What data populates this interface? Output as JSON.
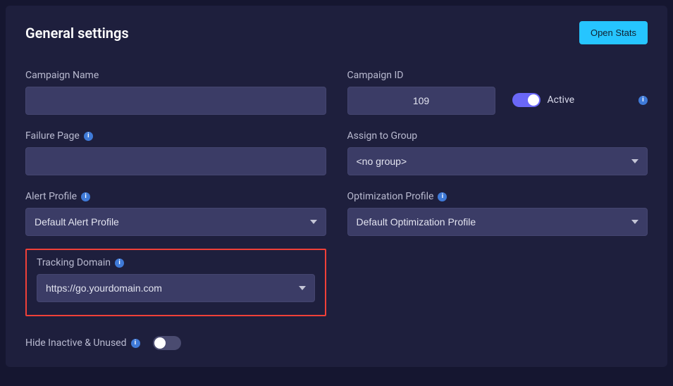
{
  "header": {
    "title": "General settings",
    "open_stats_label": "Open Stats"
  },
  "fields": {
    "campaign_name": {
      "label": "Campaign Name",
      "value": ""
    },
    "campaign_id": {
      "label": "Campaign ID",
      "value": "109"
    },
    "active": {
      "label": "Active",
      "on": true
    },
    "failure_page": {
      "label": "Failure Page",
      "value": ""
    },
    "assign_group": {
      "label": "Assign to Group",
      "selected": "<no group>"
    },
    "alert_profile": {
      "label": "Alert Profile",
      "selected": "Default Alert Profile"
    },
    "optimization_profile": {
      "label": "Optimization Profile",
      "selected": "Default Optimization Profile"
    },
    "tracking_domain": {
      "label": "Tracking Domain",
      "selected": "https://go.yourdomain.com"
    },
    "hide_inactive": {
      "label": "Hide Inactive & Unused",
      "on": false
    }
  },
  "info_glyph": "i"
}
